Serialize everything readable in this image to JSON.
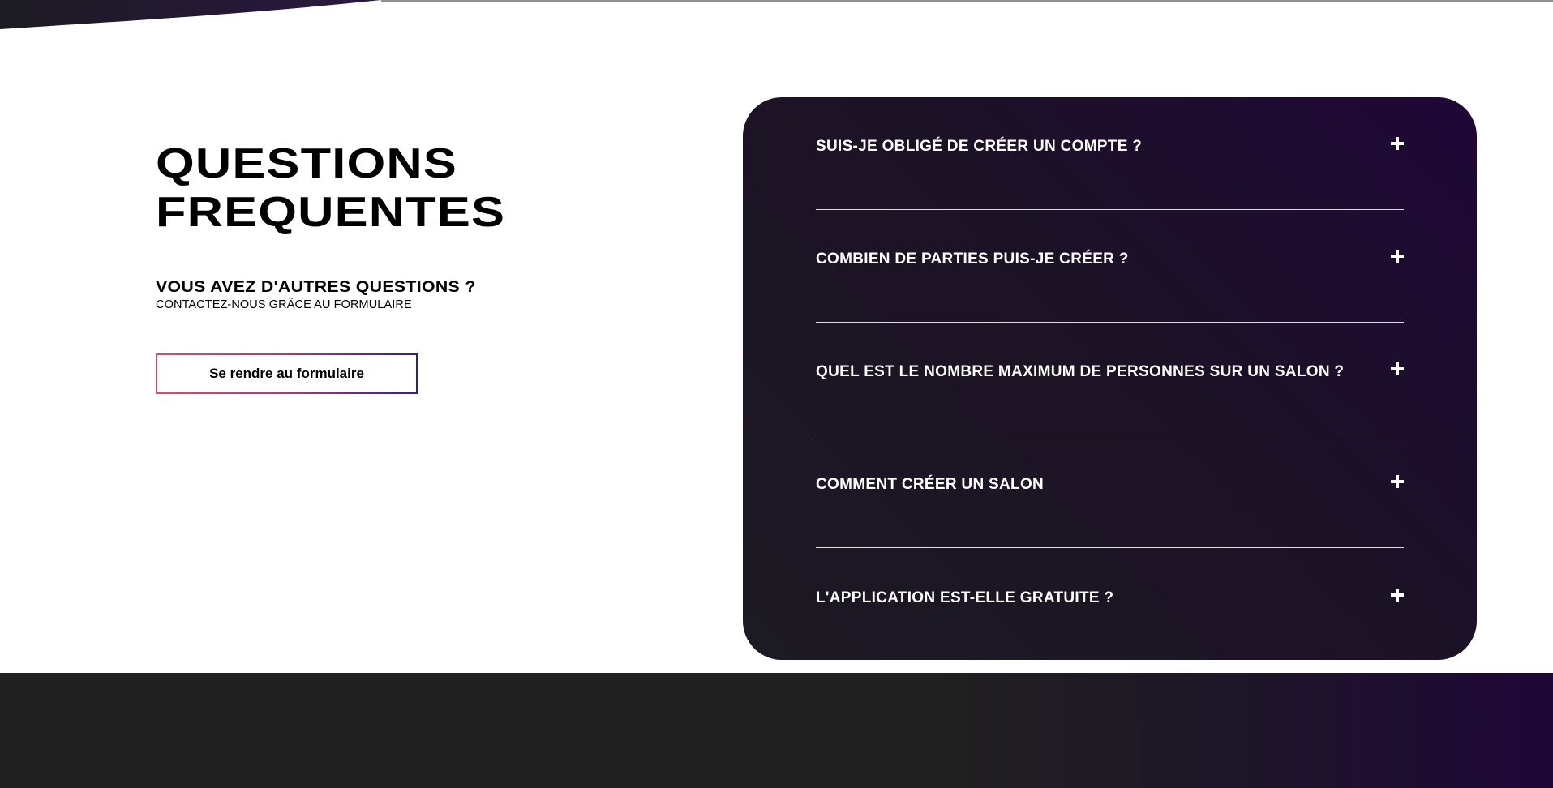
{
  "faq_intro": {
    "title_line1": "QUESTIONS",
    "title_line2": "FREQUENTES",
    "sub_heading": "VOUS AVEZ D'AUTRES QUESTIONS ?",
    "sub_text": "CONTACTEZ-NOUS GRÂCE AU FORMULAIRE",
    "button_label": "Se rendre au formulaire"
  },
  "faq": {
    "items": [
      {
        "question": "SUIS-JE OBLIGÉ DE CRÉER UN COMPTE ?"
      },
      {
        "question": "COMBIEN DE PARTIES PUIS-JE CRÉER ?"
      },
      {
        "question": "QUEL EST LE NOMBRE MAXIMUM DE PERSONNES SUR UN SALON ?"
      },
      {
        "question": "COMMENT CRÉER UN SALON"
      },
      {
        "question": "L'APPLICATION EST-ELLE GRATUITE ?"
      }
    ],
    "expand_icon": "plus-icon"
  },
  "colors": {
    "panel_dark": "#1c1a22",
    "panel_purple": "#1f0738",
    "button_gradient_start": "#e24a5d",
    "button_gradient_end": "#3b1a86",
    "footer": "#202020"
  }
}
